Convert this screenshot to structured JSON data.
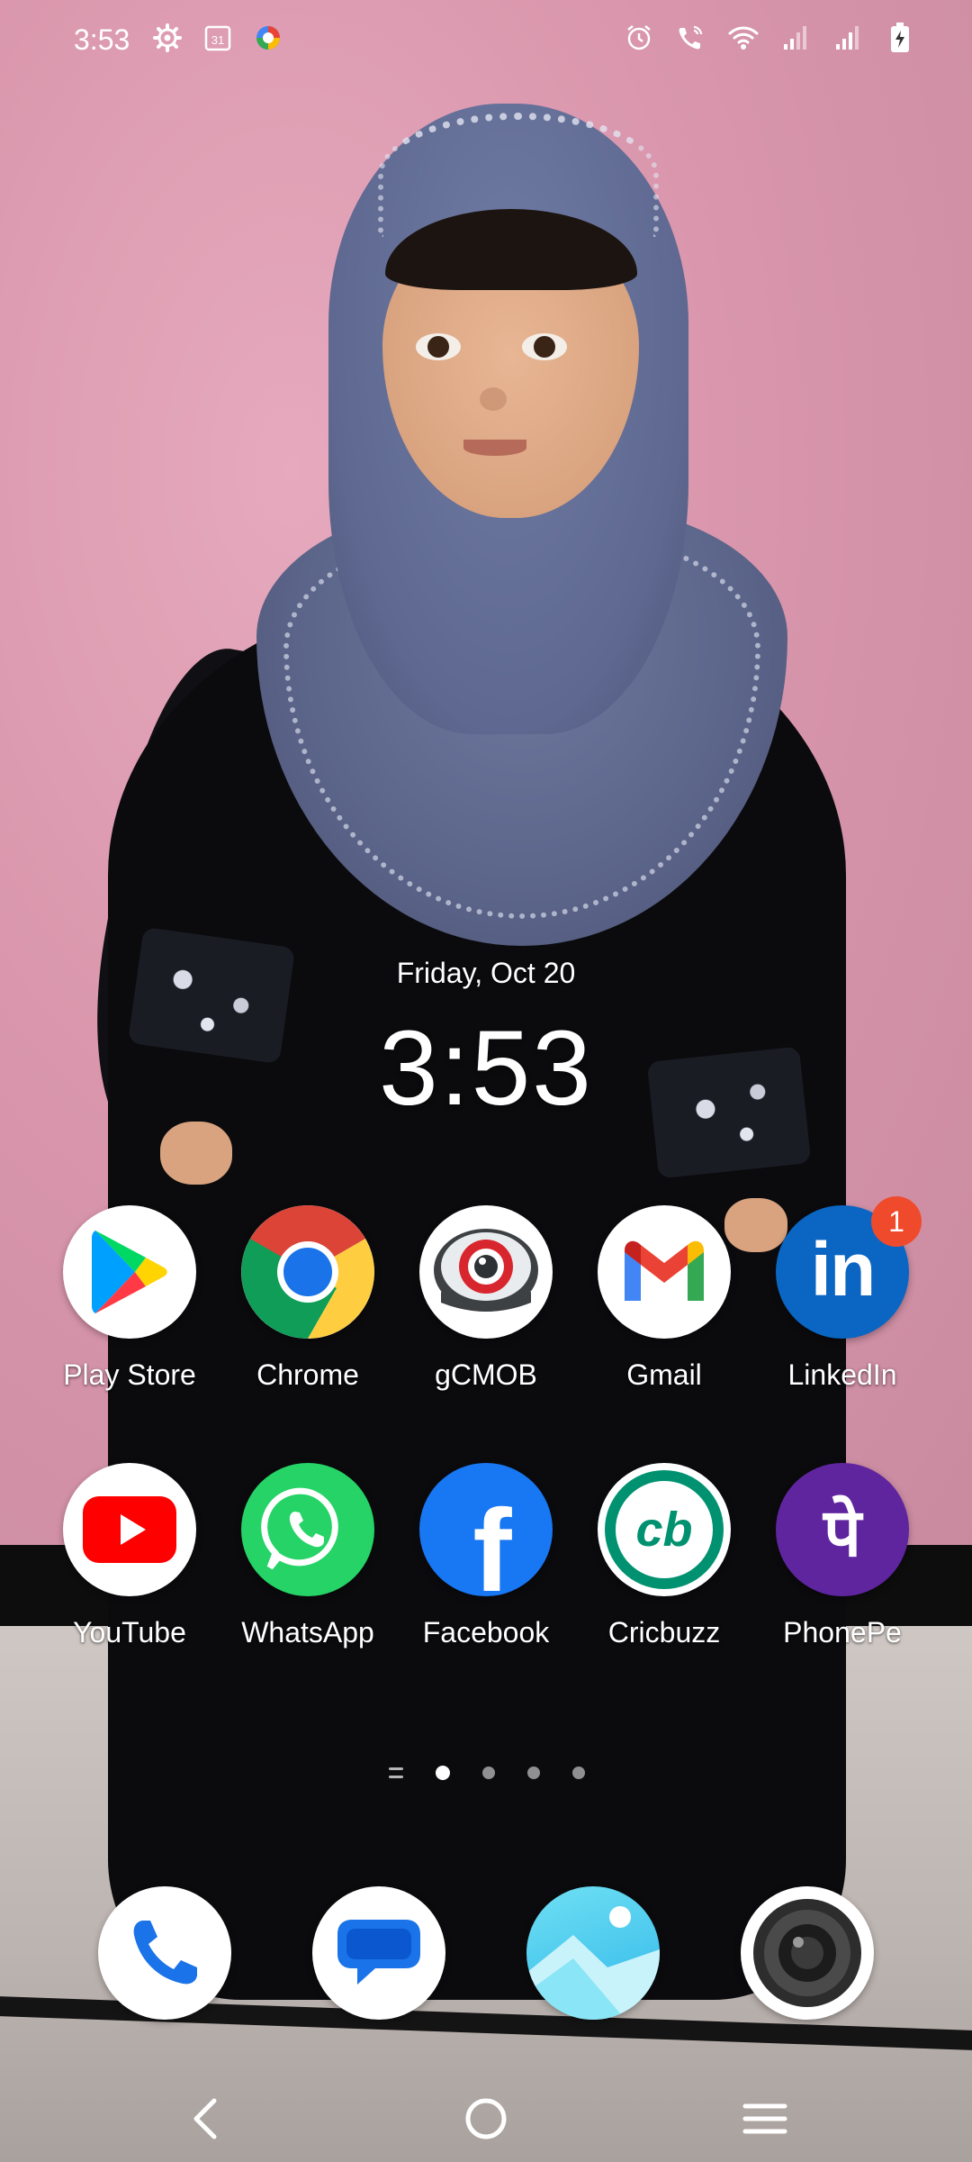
{
  "status_bar": {
    "time": "3:53",
    "left_icons": [
      "gear-icon",
      "calendar-icon",
      "assistant-icon"
    ],
    "calendar_day": "31",
    "right_icons": [
      "alarm-icon",
      "wifi-calling-icon",
      "wifi-icon",
      "signal-icon",
      "signal-icon",
      "battery-charging-icon"
    ]
  },
  "clock_widget": {
    "date": "Friday, Oct 20",
    "time": "3:53"
  },
  "apps": [
    {
      "label": "Play Store",
      "icon": "play-store-icon"
    },
    {
      "label": "Chrome",
      "icon": "chrome-icon"
    },
    {
      "label": "gCMOB",
      "icon": "gcmob-icon"
    },
    {
      "label": "Gmail",
      "icon": "gmail-icon"
    },
    {
      "label": "LinkedIn",
      "icon": "linkedin-icon",
      "badge": "1",
      "glyph": "in"
    },
    {
      "label": "YouTube",
      "icon": "youtube-icon"
    },
    {
      "label": "WhatsApp",
      "icon": "whatsapp-icon"
    },
    {
      "label": "Facebook",
      "icon": "facebook-icon",
      "glyph": "f"
    },
    {
      "label": "Cricbuzz",
      "icon": "cricbuzz-icon",
      "glyph": "cb"
    },
    {
      "label": "PhonePe",
      "icon": "phonepe-icon",
      "glyph": "पे"
    }
  ],
  "page_indicator": {
    "pages": 4,
    "active": 1
  },
  "dock": [
    {
      "icon": "phone-icon"
    },
    {
      "icon": "messages-icon"
    },
    {
      "icon": "gallery-icon"
    },
    {
      "icon": "camera-icon"
    }
  ],
  "nav": [
    "back-icon",
    "home-icon",
    "recents-icon"
  ],
  "colors": {
    "linkedin": "#0a66c2",
    "facebook": "#1877f2",
    "whatsapp": "#25d366",
    "cricbuzz": "#009270",
    "phonepe": "#5f259f",
    "youtube": "#ff0000",
    "badge": "#f04a2c"
  }
}
